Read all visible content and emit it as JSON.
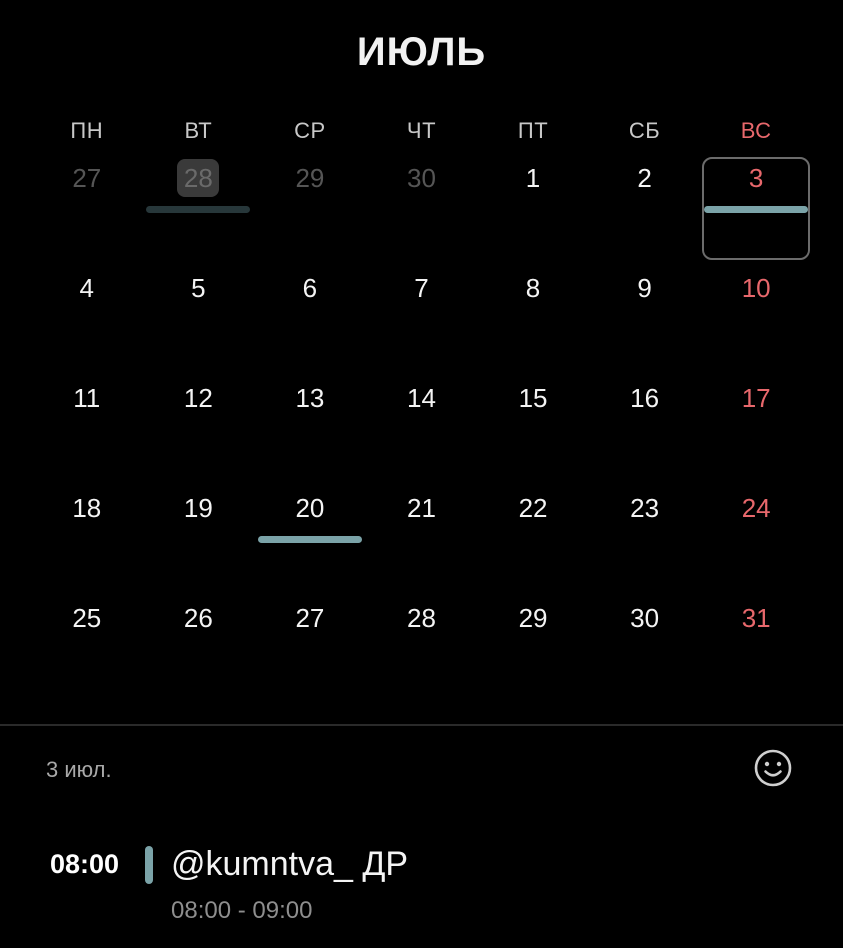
{
  "month": {
    "title": "ИЮЛЬ"
  },
  "weekdays": [
    "ПН",
    "ВТ",
    "СР",
    "ЧТ",
    "ПТ",
    "СБ",
    "ВС"
  ],
  "weeks": [
    [
      {
        "label": "27",
        "other": true
      },
      {
        "label": "28",
        "other": true,
        "today_dim": true,
        "event": "dim"
      },
      {
        "label": "29",
        "other": true
      },
      {
        "label": "30",
        "other": true
      },
      {
        "label": "1"
      },
      {
        "label": "2"
      },
      {
        "label": "3",
        "sunday": true,
        "selected": true,
        "event": "bright"
      }
    ],
    [
      {
        "label": "4"
      },
      {
        "label": "5"
      },
      {
        "label": "6"
      },
      {
        "label": "7"
      },
      {
        "label": "8"
      },
      {
        "label": "9"
      },
      {
        "label": "10",
        "sunday": true
      }
    ],
    [
      {
        "label": "11"
      },
      {
        "label": "12"
      },
      {
        "label": "13"
      },
      {
        "label": "14"
      },
      {
        "label": "15"
      },
      {
        "label": "16"
      },
      {
        "label": "17",
        "sunday": true
      }
    ],
    [
      {
        "label": "18"
      },
      {
        "label": "19"
      },
      {
        "label": "20",
        "event": "bright"
      },
      {
        "label": "21"
      },
      {
        "label": "22"
      },
      {
        "label": "23"
      },
      {
        "label": "24",
        "sunday": true
      }
    ],
    [
      {
        "label": "25"
      },
      {
        "label": "26"
      },
      {
        "label": "27"
      },
      {
        "label": "28"
      },
      {
        "label": "29"
      },
      {
        "label": "30"
      },
      {
        "label": "31",
        "sunday": true
      }
    ]
  ],
  "agenda": {
    "date_label": "3 июл.",
    "emoji_icon": "smiley-icon",
    "events": [
      {
        "time": "08:00",
        "title": "@kumntva_ ДР",
        "range": "08:00 - 09:00",
        "color": "#7ba3a8"
      }
    ]
  },
  "colors": {
    "background": "#000000",
    "sunday": "#e8686c",
    "event": "#7ba3a8",
    "event_dim": "#27373a",
    "muted": "#555555"
  }
}
